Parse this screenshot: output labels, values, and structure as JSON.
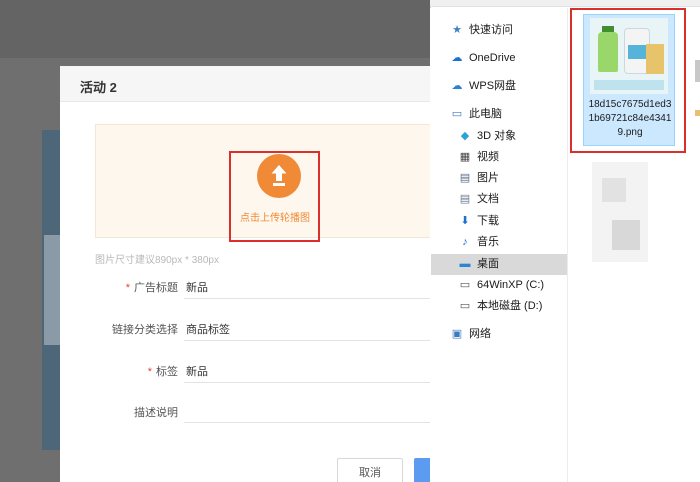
{
  "dialog": {
    "title": "活动 2",
    "upload_label": "点击上传轮播图",
    "size_hint": "图片尺寸建议890px * 380px",
    "fields": [
      {
        "label": "广告标题",
        "required": true,
        "value": "新品"
      },
      {
        "label": "链接分类选择",
        "required": false,
        "value": "商品标签"
      },
      {
        "label": "标签",
        "required": true,
        "value": "新品"
      },
      {
        "label": "描述说明",
        "required": false,
        "value": ""
      }
    ],
    "required_mark": "*",
    "cancel_label": "取消"
  },
  "file_dialog": {
    "nav": [
      {
        "label": "快速访问",
        "icon": "star-icon"
      },
      {
        "label": "OneDrive",
        "icon": "cloud-icon"
      },
      {
        "label": "WPS网盘",
        "icon": "cloud-icon"
      },
      {
        "label": "此电脑",
        "icon": "computer-icon"
      },
      {
        "label": "3D 对象",
        "icon": "cube-icon"
      },
      {
        "label": "视频",
        "icon": "video-icon"
      },
      {
        "label": "图片",
        "icon": "picture-icon"
      },
      {
        "label": "文档",
        "icon": "document-icon"
      },
      {
        "label": "下载",
        "icon": "download-icon"
      },
      {
        "label": "音乐",
        "icon": "music-icon"
      },
      {
        "label": "桌面",
        "icon": "desktop-icon",
        "selected": true
      },
      {
        "label": "64WinXP  (C:)",
        "icon": "drive-icon"
      },
      {
        "label": "本地磁盘 (D:)",
        "icon": "drive-icon"
      },
      {
        "label": "网络",
        "icon": "network-icon"
      }
    ],
    "file": {
      "name": "18d15c7675d1ed31b69721c84e43419.png",
      "icon": "image-thumbnail"
    }
  },
  "colors": {
    "accent_orange": "#f08a36",
    "highlight_red": "#d9302e",
    "required_red": "#e0453c",
    "selection_blue": "#cce8ff",
    "primary_blue": "#5b9bf0"
  }
}
